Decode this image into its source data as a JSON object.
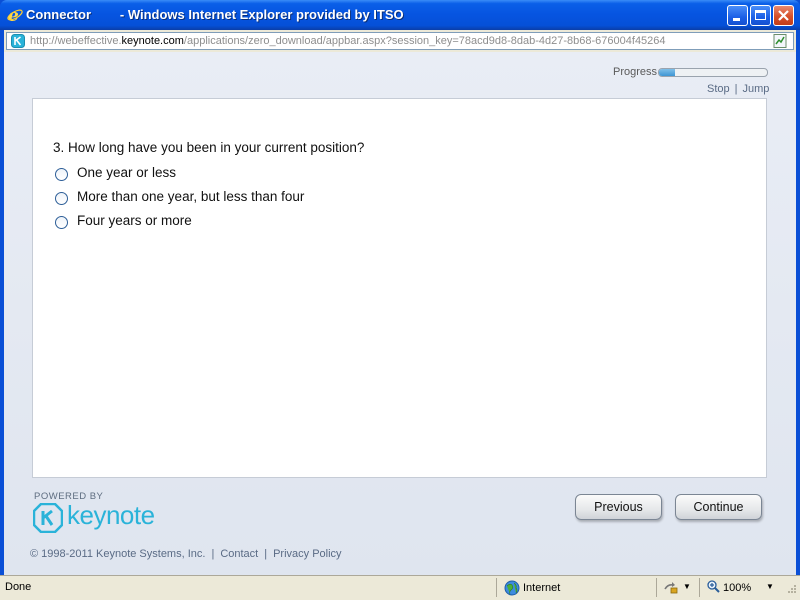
{
  "window": {
    "title": "Connector        - Windows Internet Explorer provided by ITSO"
  },
  "address_bar": {
    "url_prefix": "http://webeffective.",
    "url_host": "keynote.com",
    "url_path": "/applications/zero_download/appbar.aspx?session_key=78acd9d8-8dab-4d27-8b68-676004f45264"
  },
  "toolbar": {
    "progress_label": "Progress",
    "progress_fraction": 0.15,
    "stop_label": "Stop",
    "separator": "|",
    "jump_label": "Jump"
  },
  "survey": {
    "question": "3. How long have you been in your current position?",
    "options": [
      {
        "label": "One year or less",
        "selected": false
      },
      {
        "label": "More than one year, but less than four",
        "selected": false
      },
      {
        "label": "Four years or more",
        "selected": false
      }
    ]
  },
  "branding": {
    "powered_by": "POWERED BY",
    "logo_text": "keynote",
    "accent_color": "#2ab3d9"
  },
  "nav": {
    "previous_label": "Previous",
    "continue_label": "Continue"
  },
  "footer": {
    "copyright": "© 1998-2011 Keynote Systems, Inc.",
    "contact": "Contact",
    "privacy": "Privacy Policy",
    "separator": "|"
  },
  "statusbar": {
    "status": "Done",
    "zone": "Internet",
    "zoom": "100%",
    "dropdown_glyph": "▼"
  }
}
